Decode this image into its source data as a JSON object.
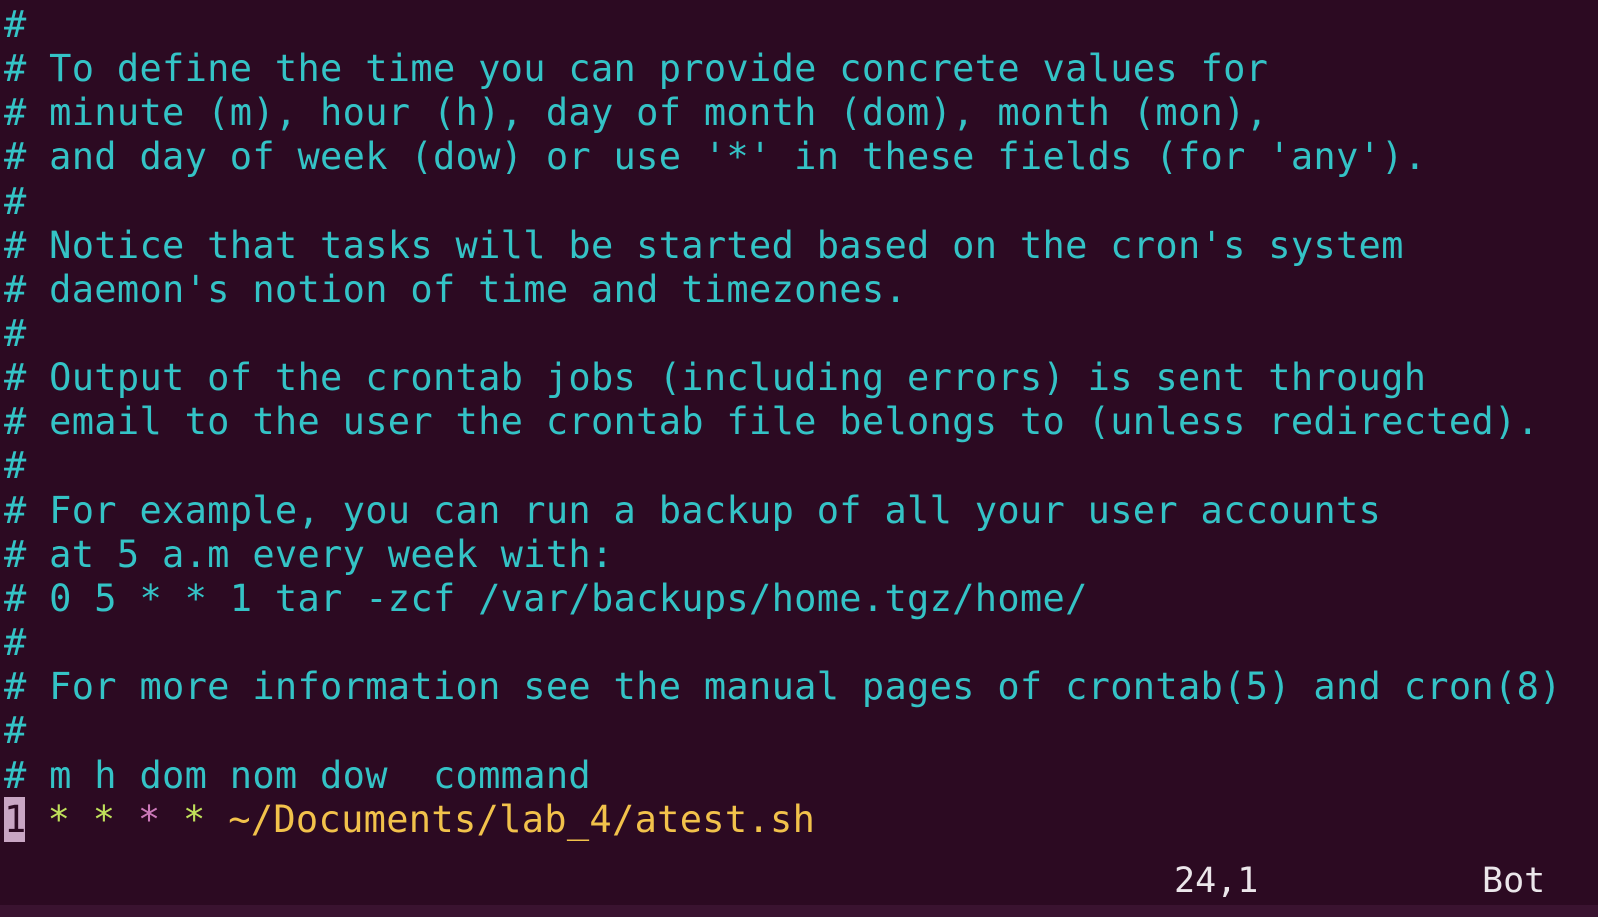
{
  "editor": {
    "comment_lines": [
      "#",
      "# To define the time you can provide concrete values for",
      "# minute (m), hour (h), day of month (dom), month (mon),",
      "# and day of week (dow) or use '*' in these fields (for 'any').",
      "#",
      "# Notice that tasks will be started based on the cron's system",
      "# daemon's notion of time and timezones.",
      "#",
      "# Output of the crontab jobs (including errors) is sent through",
      "# email to the user the crontab file belongs to (unless redirected).",
      "#",
      "# For example, you can run a backup of all your user accounts",
      "# at 5 a.m every week with:",
      "# 0 5 * * 1 tar -zcf /var/backups/home.tgz/home/",
      "#",
      "# For more information see the manual pages of crontab(5) and cron(8)",
      "#",
      "# m h dom nom dow  command"
    ],
    "active_line": {
      "cursor_char": "1",
      "fields": [
        "*",
        "*",
        "*",
        "*"
      ],
      "command": "~/Documents/lab_4/atest.sh"
    }
  },
  "status_bar": {
    "position": "24,1",
    "scroll": "Bot"
  },
  "colors": {
    "background": "#2c0a22",
    "comment": "#34c3c6",
    "path": "#f2c24b",
    "star_green": "#c0e05b",
    "star_pink": "#cc79b9"
  }
}
